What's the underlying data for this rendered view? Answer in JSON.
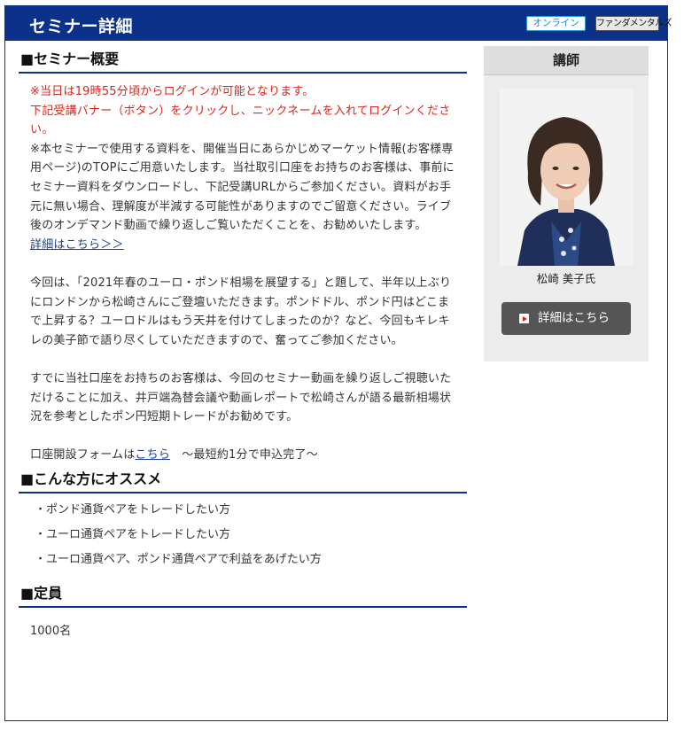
{
  "header": {
    "title": "セミナー詳細",
    "tag_online": "オンライン",
    "tag_category": "ファンダメンタルズ"
  },
  "overview": {
    "heading": "■セミナー概要",
    "notice_red_1": "※当日は19時55分頃からログインが可能となります。",
    "notice_red_2": "下記受講バナー（ボタン）をクリックし、ニックネームを入れてログインください。",
    "notice_material": "※本セミナーで使用する資料を、開催当日にあらかじめマーケット情報(お客様専用ページ)のTOPにご用意いたします。当社取引口座をお持ちのお客様は、事前にセミナー資料をダウンロードし、下記受講URLからご参加ください。資料がお手元に無い場合、理解度が半減する可能性がありますのでご留意ください。ライブ後のオンデマンド動画で繰り返しご覧いただくことを、お勧めいたします。",
    "detail_link": "詳細はこちら＞＞",
    "para_1": "今回は、「2021年春のユーロ・ポンド相場を展望する」と題して、半年以上ぶりにロンドンから松崎さんにご登壇いただきます。ポンドドル、ポンド円はどこまで上昇する？ユーロドルはもう天井を付けてしまったのか？など、今回もキレキレの美子節で語り尽くしていただきますので、奮ってご参加ください。",
    "para_2": "すでに当社口座をお持ちのお客様は、今回のセミナー動画を繰り返しご視聴いただけることに加え、井戸端為替会議や動画レポートで松崎さんが語る最新相場状況を参考としたポン円短期トレードがお勧めです。",
    "account_prefix": "口座開設フォームは",
    "account_link": "こちら",
    "account_suffix": "　～最短約1分で申込完了～"
  },
  "recommend": {
    "heading": "■こんな方にオススメ",
    "items": [
      "ポンド通貨ペアをトレードしたい方",
      "ユーロ通貨ペアをトレードしたい方",
      "ユーロ通貨ペア、ポンド通貨ペアで利益をあげたい方"
    ]
  },
  "capacity": {
    "heading": "■定員",
    "value": "1000名"
  },
  "instructor": {
    "heading": "講師",
    "name": "松崎 美子氏",
    "button_label": "詳細はこちら",
    "button_icon": "play-icon"
  },
  "colors": {
    "header_bg": "#0b3188",
    "notice_red": "#d7261b",
    "link": "#1a3f8a",
    "button_bg": "#555555"
  }
}
